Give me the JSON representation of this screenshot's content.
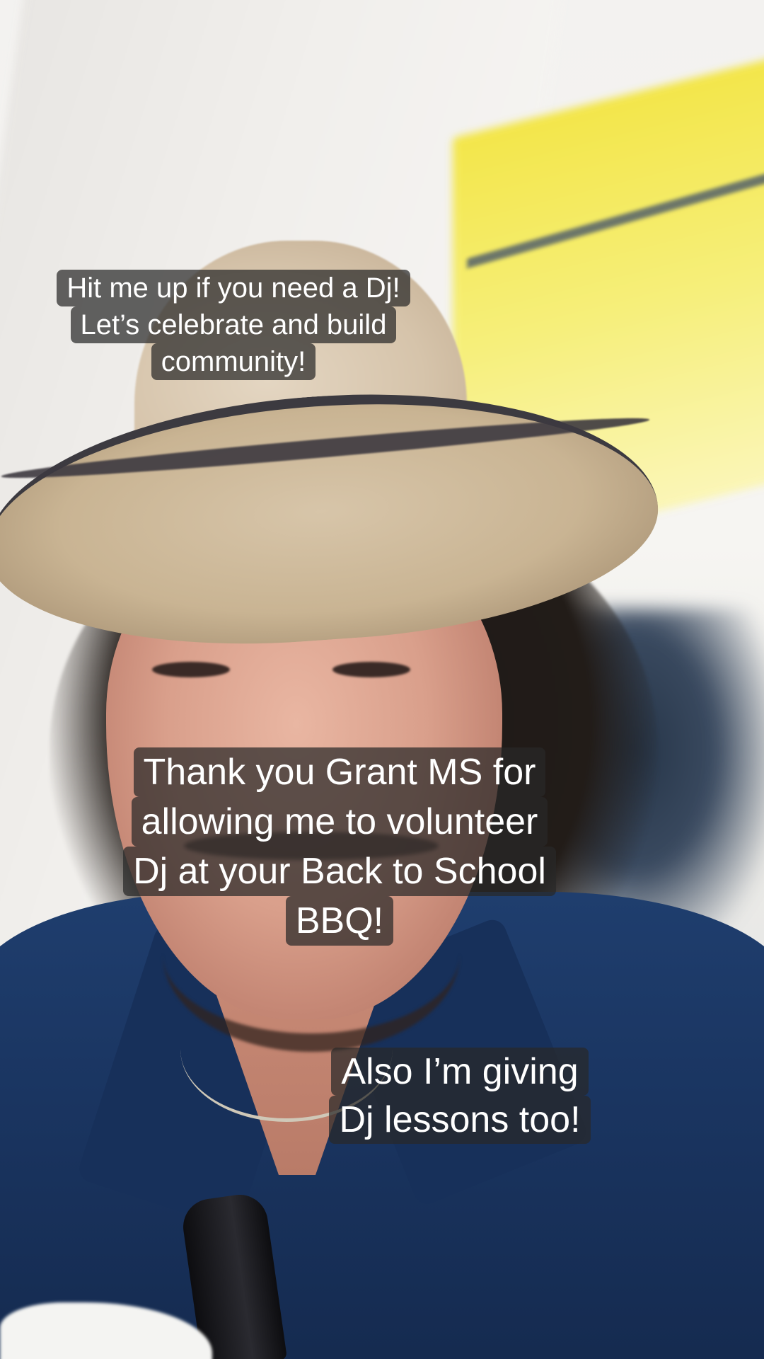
{
  "captions": {
    "top": {
      "lines": [
        "Hit me up if you need a Dj!",
        "Let’s celebrate and build",
        "community!"
      ]
    },
    "middle": {
      "lines": [
        "Thank you Grant MS for",
        "allowing me to volunteer",
        "Dj at your Back to School",
        "BBQ!"
      ]
    },
    "bottom": {
      "lines": [
        "Also I’m giving",
        "Dj lessons too!"
      ]
    }
  },
  "colors": {
    "caption_bg": "#282828",
    "caption_text": "#ffffff",
    "shirt": "#1f3e6e",
    "yellow_wall": "#f3e64a"
  }
}
